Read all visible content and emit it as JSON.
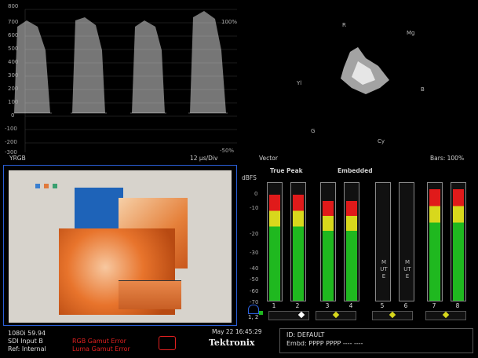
{
  "waveform": {
    "title": "YRGB",
    "timebase": "12 µs/Div",
    "scale": [
      "800",
      "700",
      "600",
      "500",
      "400",
      "300",
      "200",
      "100",
      "0",
      "-100",
      "-200",
      "-300"
    ],
    "pct_top": "100%",
    "pct_bottom": "-50%"
  },
  "vector": {
    "title": "Vector",
    "bars": "Bars: 100%",
    "targets": [
      "R",
      "Mg",
      "B",
      "Cy",
      "G",
      "Yl"
    ]
  },
  "audio": {
    "header_true_peak": "True Peak",
    "header_embedded": "Embedded",
    "unit": "dBFS",
    "scale": [
      "0",
      "-10",
      "-20",
      "-30",
      "-40",
      "-50",
      "-60",
      "-70"
    ],
    "channels": [
      "1",
      "2",
      "3",
      "4",
      "5",
      "6",
      "7",
      "8"
    ],
    "mute_label": "MUTE",
    "pair_label": "1, 2",
    "channel_levels_fraction": [
      0.9,
      0.9,
      0.85,
      0.85,
      0,
      0,
      0.95,
      0.95
    ],
    "colors": {
      "green": "#1fb81f",
      "yellow": "#d8d81c",
      "red": "#e01a1a"
    }
  },
  "status_bar": {
    "format": "1080i 59.94",
    "input": "SDI Input B",
    "ref": "Ref: Internal",
    "error1": "RGB Gamut Error",
    "error2": "Luma Gamut Error",
    "timestamp": "May 22 16:45:29",
    "brand": "Tektronix",
    "id": "ID: DEFAULT",
    "embd": "Embd: PPPP PPPP ---- ----"
  },
  "colors": {
    "pane_border": "#2a5fd8",
    "error": "#e02020"
  }
}
